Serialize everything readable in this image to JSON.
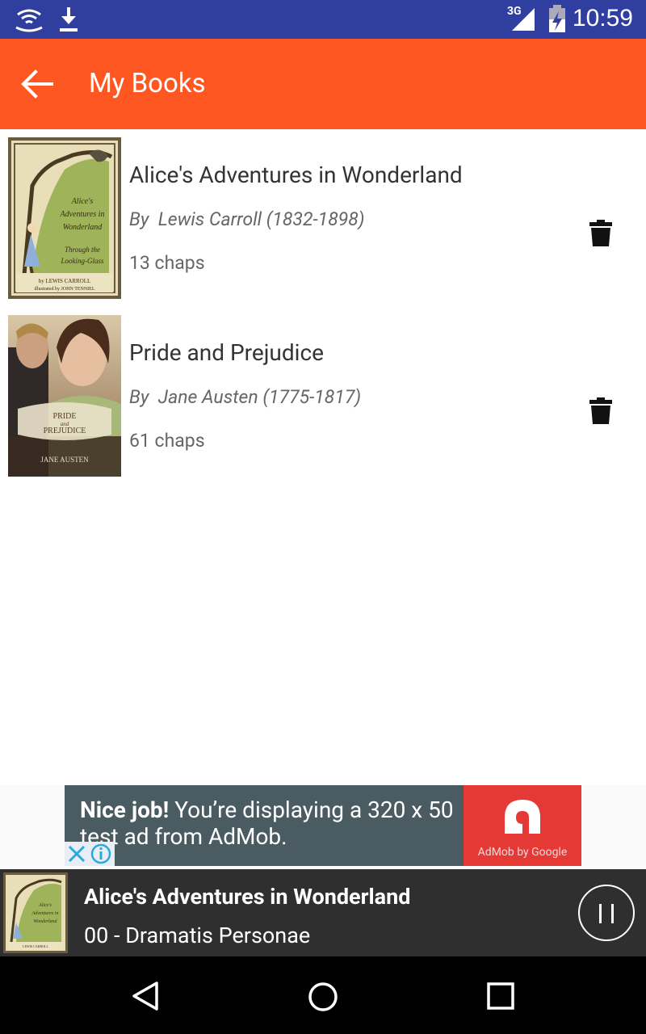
{
  "status_bar": {
    "time": "10:59",
    "network_label": "3G",
    "icons": [
      "wifi-hotspot-icon",
      "download-icon",
      "signal-3g-icon",
      "battery-charging-icon"
    ]
  },
  "app_bar": {
    "title": "My Books",
    "back_icon": "arrow-left-icon",
    "color": "#ff5722"
  },
  "books": [
    {
      "title": "Alice's Adventures in Wonderland",
      "author": "By  Lewis Carroll (1832-1898)",
      "chapters": "13 chaps"
    },
    {
      "title": "Pride and Prejudice",
      "author": "By  Jane Austen (1775-1817)",
      "chapters": "61 chaps"
    }
  ],
  "ad": {
    "headline": "Nice job!",
    "body": " You’re displaying a 320 x 50 test ad from AdMob.",
    "brand": "AdMob by Google"
  },
  "player": {
    "book_title": "Alice's Adventures in Wonderland",
    "track": "00 - Dramatis Personae",
    "control_icon": "pause-icon"
  },
  "nav_bar": {
    "icons": [
      "back-triangle-icon",
      "home-circle-icon",
      "recents-square-icon"
    ]
  },
  "colors": {
    "status_bar": "#303f9f",
    "app_bar": "#ff5722",
    "player": "#2f2f2f",
    "ad_background": "#4b5b62",
    "ad_logo": "#e53935"
  }
}
